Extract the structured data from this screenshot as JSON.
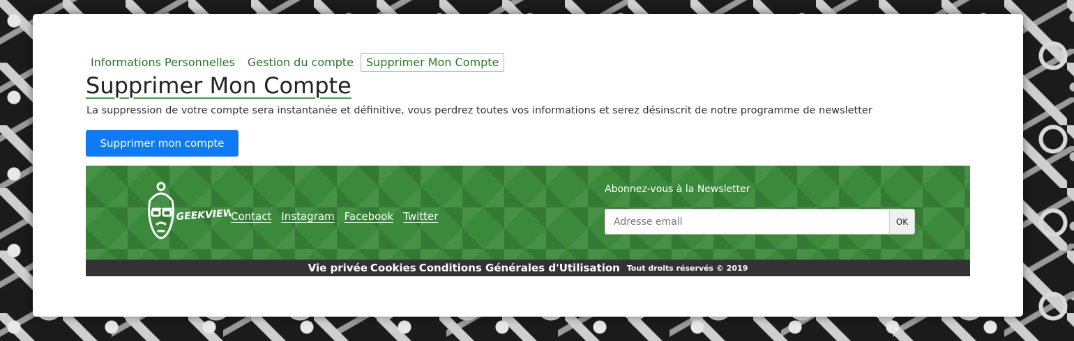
{
  "tabs": [
    {
      "label": "Informations Personnelles",
      "active": false
    },
    {
      "label": "Gestion du compte",
      "active": false
    },
    {
      "label": "Supprimer Mon Compte",
      "active": true
    }
  ],
  "main": {
    "title": "Supprimer Mon Compte",
    "description": "La suppression de votre compte sera instantanée et définitive, vous perdrez toutes vos informations et serez désinscrit de notre programme de newsletter",
    "delete_button_label": "Supprimer mon compte"
  },
  "footer": {
    "logo_text": "GEEKVIEW",
    "links": [
      "Contact",
      "Instagram",
      "Facebook",
      "Twitter"
    ],
    "newsletter": {
      "title": "Abonnez-vous à la Newsletter",
      "email_placeholder": "Adresse email",
      "email_value": "",
      "submit_label": "OK"
    },
    "legal_links": [
      "Vie privée",
      "Cookies",
      "Conditions Générales d'Utilisation"
    ],
    "copyright": "Tout droits réservés © 2019"
  },
  "colors": {
    "accent_green": "#1f7a1f",
    "footer_green": "#3b8a3b",
    "primary_blue": "#0d7bf5",
    "footer_bar": "#333333"
  },
  "icons": {
    "logo": "geekview-bearded-man-logo"
  }
}
